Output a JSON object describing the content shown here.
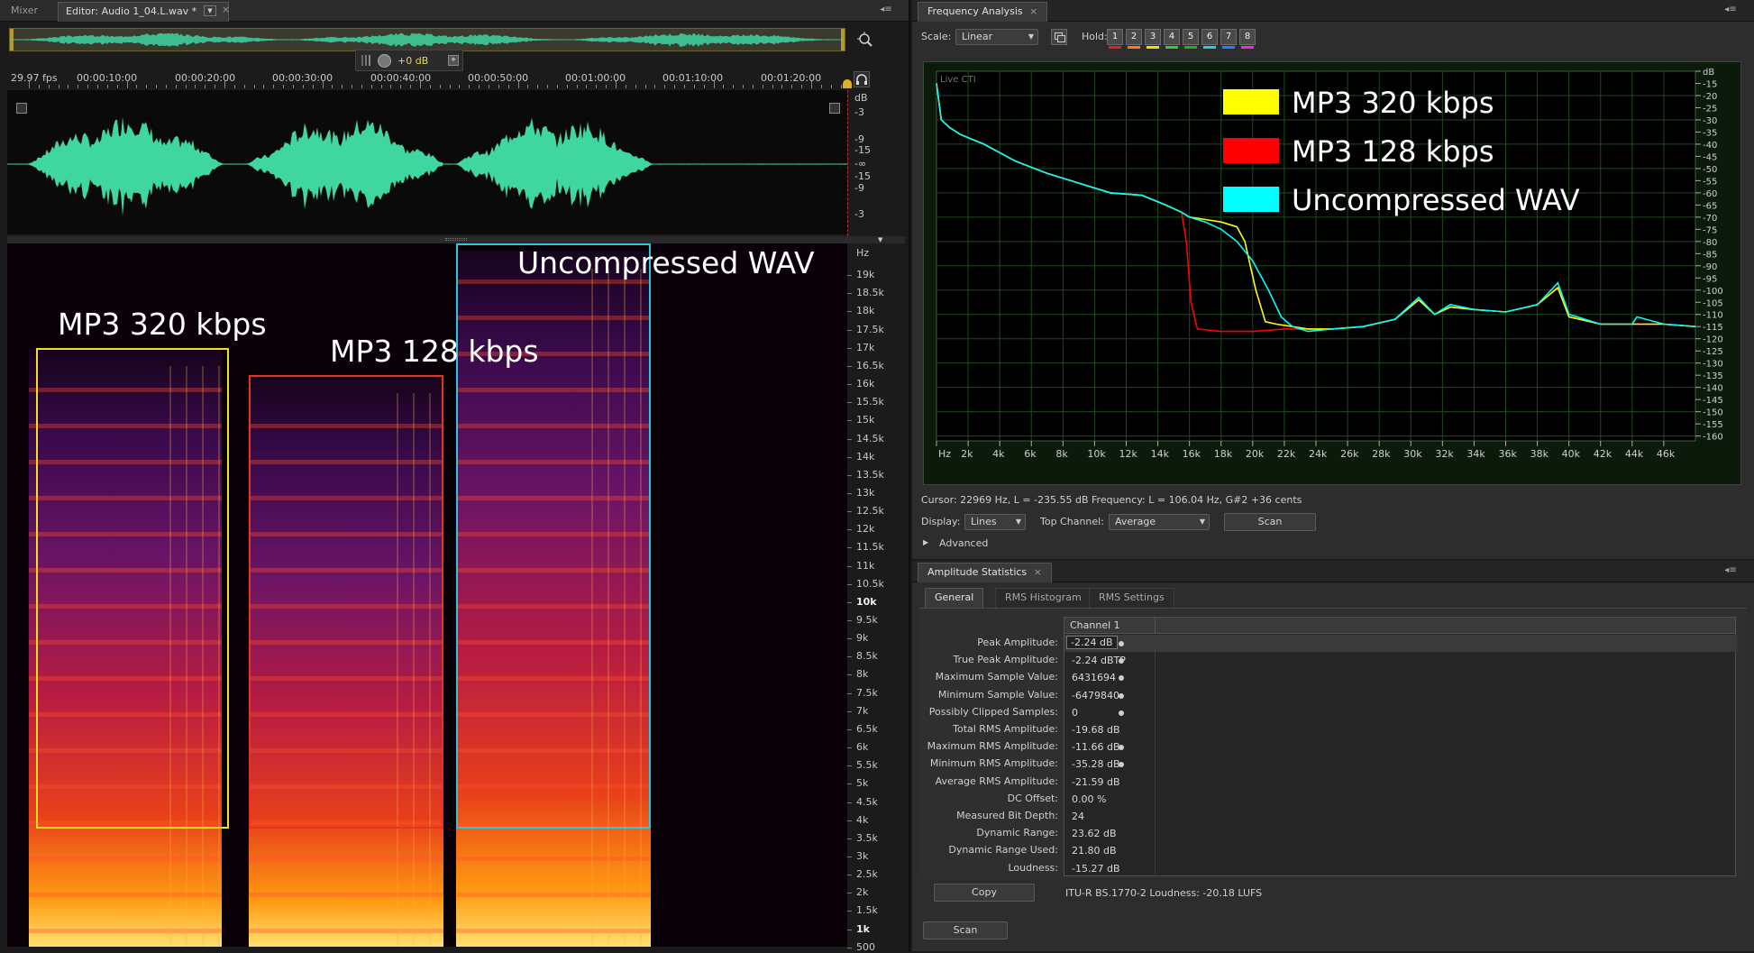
{
  "editor": {
    "tabs": [
      {
        "label": "Mixer"
      },
      {
        "label": "Editor: Audio 1_04.L.wav *"
      }
    ],
    "fps": "29.97 fps",
    "time_labels": [
      "00:00:10:00",
      "00:00:20:00",
      "00:00:30:00",
      "00:00:40:00",
      "00:00:50:00",
      "00:01:00:00",
      "00:01:10:00",
      "00:01:20:00"
    ],
    "volume_value": "+0 dB",
    "waveform_scale": [
      "dB",
      "-3",
      "-9",
      "-15",
      "-∞",
      "-15",
      "-9",
      "-3"
    ],
    "spectrum_scale": [
      "Hz",
      "19k",
      "18.5k",
      "18k",
      "17.5k",
      "17k",
      "16.5k",
      "16k",
      "15.5k",
      "15k",
      "14.5k",
      "14k",
      "13.5k",
      "13k",
      "12.5k",
      "12k",
      "11.5k",
      "11k",
      "10.5k",
      "10k",
      "9.5k",
      "9k",
      "8.5k",
      "8k",
      "7.5k",
      "7k",
      "6.5k",
      "6k",
      "5.5k",
      "5k",
      "4.5k",
      "4k",
      "3.5k",
      "3k",
      "2.5k",
      "2k",
      "1.5k",
      "1k",
      "500"
    ],
    "annotations": [
      {
        "label": "MP3 320 kbps",
        "color": "#f2e21a"
      },
      {
        "label": "MP3 128 kbps",
        "color": "#e53325"
      },
      {
        "label": "Uncompressed WAV",
        "color": "#2ec6d8"
      }
    ],
    "waveform_color": "#3fd6a0"
  },
  "freq": {
    "title": "Frequency Analysis",
    "scale_label": "Scale:",
    "scale_value": "Linear",
    "hold_label": "Hold:",
    "holds": [
      {
        "label": "1",
        "color": "#e02020"
      },
      {
        "label": "2",
        "color": "#ff7a1a"
      },
      {
        "label": "3",
        "color": "#f0e000"
      },
      {
        "label": "4",
        "color": "#30d030"
      },
      {
        "label": "5",
        "color": "#20b020"
      },
      {
        "label": "6",
        "color": "#20d0e0"
      },
      {
        "label": "7",
        "color": "#2080ff"
      },
      {
        "label": "8",
        "color": "#e030e0"
      }
    ],
    "live_cti": "Live CTI",
    "legend": [
      {
        "label": "MP3 320 kbps",
        "color": "#ffff00"
      },
      {
        "label": "MP3 128 kbps",
        "color": "#ff0000"
      },
      {
        "label": "Uncompressed WAV",
        "color": "#00ffff"
      }
    ],
    "cursor_text": "Cursor: 22969 Hz, L = -235.55 dB   Frequency: L = 106.04 Hz, G#2 +36 cents",
    "display_label": "Display:",
    "display_value": "Lines",
    "top_channel_label": "Top Channel:",
    "top_channel_value": "Average",
    "scan_label": "Scan",
    "advanced_label": "Advanced",
    "chart_data": {
      "type": "line",
      "xlabel": "Hz",
      "ylabel": "dB",
      "x_ticks": [
        "Hz",
        "2k",
        "4k",
        "6k",
        "8k",
        "10k",
        "12k",
        "14k",
        "16k",
        "18k",
        "20k",
        "22k",
        "24k",
        "26k",
        "28k",
        "30k",
        "32k",
        "34k",
        "36k",
        "38k",
        "40k",
        "42k",
        "44k",
        "46k"
      ],
      "y_ticks": [
        "dB",
        "-15",
        "-20",
        "-25",
        "-30",
        "-35",
        "-40",
        "-45",
        "-50",
        "-55",
        "-60",
        "-65",
        "-70",
        "-75",
        "-80",
        "-85",
        "-90",
        "-95",
        "-100",
        "-105",
        "-110",
        "-115",
        "-120",
        "-125",
        "-130",
        "-135",
        "-140",
        "-145",
        "-150",
        "-155",
        "-160"
      ],
      "xlim": [
        0,
        48000
      ],
      "ylim": [
        -162,
        -10
      ],
      "series": [
        {
          "name": "Uncompressed WAV",
          "color": "#00ffff",
          "x": [
            0,
            300,
            800,
            1500,
            3000,
            5000,
            7000,
            9000,
            11000,
            13000,
            14500,
            15500,
            16000,
            17000,
            18000,
            19000,
            20000,
            21000,
            21800,
            22500,
            23500,
            25000,
            27000,
            29000,
            30500,
            31500,
            32500,
            34000,
            36000,
            38000,
            39300,
            40000,
            42000,
            44000,
            44300,
            46000,
            48000
          ],
          "y": [
            -15,
            -30,
            -33,
            -36,
            -40,
            -47,
            -52,
            -56,
            -60,
            -61,
            -65,
            -68,
            -70,
            -72,
            -75,
            -80,
            -88,
            -100,
            -111,
            -115,
            -117,
            -116,
            -115,
            -112,
            -103,
            -110,
            -106,
            -108,
            -109,
            -106,
            -97,
            -110,
            -114,
            -114,
            -111,
            -114,
            -115
          ]
        },
        {
          "name": "MP3 320 kbps",
          "color": "#ffff00",
          "x": [
            0,
            300,
            800,
            1500,
            3000,
            5000,
            7000,
            9000,
            11000,
            13000,
            14500,
            15500,
            16000,
            17000,
            18000,
            19000,
            19500,
            20200,
            20800,
            21500,
            22500,
            23500,
            25000,
            27000,
            29000,
            30500,
            31500,
            32500,
            34000,
            36000,
            38000,
            39300,
            40000,
            42000,
            44000,
            46000,
            48000
          ],
          "y": [
            -15,
            -30,
            -33,
            -36,
            -40,
            -47,
            -52,
            -56,
            -60,
            -61,
            -65,
            -68,
            -70,
            -71,
            -72,
            -74,
            -80,
            -100,
            -113,
            -114,
            -115,
            -116,
            -116,
            -115,
            -112,
            -104,
            -110,
            -107,
            -108,
            -109,
            -106,
            -99,
            -111,
            -114,
            -114,
            -114,
            -115
          ]
        },
        {
          "name": "MP3 128 kbps",
          "color": "#ff0000",
          "x": [
            0,
            300,
            800,
            1500,
            3000,
            5000,
            7000,
            9000,
            11000,
            13000,
            14500,
            15500,
            15800,
            16100,
            16500,
            18000,
            20000,
            22000,
            23500,
            25000,
            27000,
            29000,
            30500,
            31500,
            32500,
            34000,
            36000,
            38000,
            39300,
            40000,
            42000,
            44000,
            46000,
            48000
          ],
          "y": [
            -15,
            -30,
            -33,
            -36,
            -40,
            -47,
            -52,
            -56,
            -60,
            -61,
            -65,
            -68,
            -80,
            -105,
            -116,
            -117,
            -117,
            -116,
            -116,
            -116,
            -115,
            -112,
            -104,
            -110,
            -107,
            -108,
            -109,
            -106,
            -99,
            -111,
            -114,
            -114,
            -114,
            -115
          ]
        }
      ]
    }
  },
  "amp": {
    "title": "Amplitude Statistics",
    "tabs": [
      {
        "label": "General"
      },
      {
        "label": "RMS Histogram"
      },
      {
        "label": "RMS Settings"
      }
    ],
    "channel_header": "Channel 1",
    "rows": [
      {
        "label": "Peak Amplitude:",
        "value": "-2.24 dB"
      },
      {
        "label": "True Peak Amplitude:",
        "value": "-2.24 dBTP"
      },
      {
        "label": "Maximum Sample Value:",
        "value": "6431694"
      },
      {
        "label": "Minimum Sample Value:",
        "value": "-6479840"
      },
      {
        "label": "Possibly Clipped Samples:",
        "value": "0"
      },
      {
        "label": "Total RMS Amplitude:",
        "value": "-19.68 dB"
      },
      {
        "label": "Maximum RMS Amplitude:",
        "value": "-11.66 dB"
      },
      {
        "label": "Minimum RMS Amplitude:",
        "value": "-35.28 dB"
      },
      {
        "label": "Average RMS Amplitude:",
        "value": "-21.59 dB"
      },
      {
        "label": "DC Offset:",
        "value": "0.00 %"
      },
      {
        "label": "Measured Bit Depth:",
        "value": "24"
      },
      {
        "label": "Dynamic Range:",
        "value": "23.62 dB"
      },
      {
        "label": "Dynamic Range Used:",
        "value": "21.80 dB"
      },
      {
        "label": "Loudness:",
        "value": "-15.27 dB"
      }
    ],
    "copy_label": "Copy",
    "loudness_text": "ITU-R BS.1770-2 Loudness: -20.18 LUFS",
    "scan_label": "Scan"
  }
}
